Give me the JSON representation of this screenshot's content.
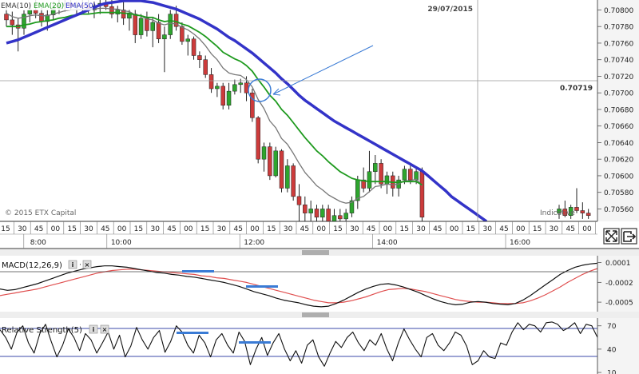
{
  "chart_data": [
    {
      "type": "candlestick",
      "legend": [
        "EMA(10)",
        "EMA(20)",
        "EMA(50)"
      ],
      "date_label": "29/07/2015",
      "price_label": "0.70719",
      "watermark": "© 2015 ETX Capital",
      "indicative": "Indicative",
      "y_ticks": [
        "0.70800",
        "0.70780",
        "0.70760",
        "0.70740",
        "0.70720",
        "0.70700",
        "0.70680",
        "0.70660",
        "0.70640",
        "0.70620",
        "0.70600",
        "0.70580",
        "0.70560"
      ],
      "ylim": [
        0.70545,
        0.70812
      ],
      "candles": [
        [
          0.70795,
          0.70805,
          0.7078,
          0.70788
        ],
        [
          0.70788,
          0.70798,
          0.7077,
          0.70782
        ],
        [
          0.70782,
          0.7079,
          0.7075,
          0.70778
        ],
        [
          0.70778,
          0.708,
          0.7077,
          0.70795
        ],
        [
          0.70795,
          0.70808,
          0.70785,
          0.708
        ],
        [
          0.708,
          0.70812,
          0.7079,
          0.70796
        ],
        [
          0.70796,
          0.70806,
          0.7078,
          0.70786
        ],
        [
          0.70786,
          0.708,
          0.70775,
          0.70794
        ],
        [
          0.70794,
          0.7081,
          0.70788,
          0.70802
        ],
        [
          0.70802,
          0.70812,
          0.70795,
          0.70806
        ],
        [
          0.70806,
          0.70812,
          0.70798,
          0.70808
        ],
        [
          0.70808,
          0.70812,
          0.708,
          0.70804
        ],
        [
          0.70804,
          0.7081,
          0.70795,
          0.70806
        ],
        [
          0.70806,
          0.70812,
          0.70798,
          0.70804
        ],
        [
          0.70804,
          0.70812,
          0.70796,
          0.708
        ],
        [
          0.708,
          0.7081,
          0.7079,
          0.70805
        ],
        [
          0.70805,
          0.70812,
          0.70795,
          0.70808
        ],
        [
          0.70808,
          0.70812,
          0.708,
          0.70804
        ],
        [
          0.70804,
          0.70812,
          0.7079,
          0.70795
        ],
        [
          0.70795,
          0.70805,
          0.70785,
          0.708
        ],
        [
          0.708,
          0.7081,
          0.70782,
          0.7079
        ],
        [
          0.7079,
          0.708,
          0.70775,
          0.70795
        ],
        [
          0.70795,
          0.708,
          0.7076,
          0.7077
        ],
        [
          0.7077,
          0.70795,
          0.70765,
          0.7079
        ],
        [
          0.7079,
          0.70798,
          0.70768,
          0.70775
        ],
        [
          0.70775,
          0.7079,
          0.70755,
          0.70785
        ],
        [
          0.70785,
          0.70795,
          0.7076,
          0.70765
        ],
        [
          0.70765,
          0.7078,
          0.70725,
          0.7077
        ],
        [
          0.7077,
          0.708,
          0.70765,
          0.70795
        ],
        [
          0.70795,
          0.70805,
          0.70775,
          0.7078
        ],
        [
          0.7078,
          0.70785,
          0.70758,
          0.70762
        ],
        [
          0.70762,
          0.7077,
          0.70745,
          0.70765
        ],
        [
          0.70765,
          0.70768,
          0.7074,
          0.70745
        ],
        [
          0.70745,
          0.7075,
          0.7073,
          0.7074
        ],
        [
          0.7074,
          0.70745,
          0.70718,
          0.70722
        ],
        [
          0.70722,
          0.7073,
          0.707,
          0.70705
        ],
        [
          0.70705,
          0.70712,
          0.70695,
          0.70708
        ],
        [
          0.70708,
          0.70712,
          0.7068,
          0.70685
        ],
        [
          0.70685,
          0.70712,
          0.7068,
          0.70702
        ],
        [
          0.70702,
          0.70716,
          0.70698,
          0.7071
        ],
        [
          0.7071,
          0.70717,
          0.707,
          0.70712
        ],
        [
          0.70712,
          0.7072,
          0.7069,
          0.707
        ],
        [
          0.707,
          0.70705,
          0.70665,
          0.7067
        ],
        [
          0.7067,
          0.70672,
          0.70615,
          0.7062
        ],
        [
          0.7062,
          0.7064,
          0.70605,
          0.70635
        ],
        [
          0.70635,
          0.7064,
          0.70595,
          0.706
        ],
        [
          0.706,
          0.70635,
          0.70598,
          0.7063
        ],
        [
          0.7063,
          0.70632,
          0.7058,
          0.70585
        ],
        [
          0.70585,
          0.7062,
          0.7058,
          0.70612
        ],
        [
          0.70612,
          0.70615,
          0.7057,
          0.70575
        ],
        [
          0.70575,
          0.7059,
          0.70545,
          0.70565
        ],
        [
          0.70565,
          0.70575,
          0.70545,
          0.70555
        ],
        [
          0.70555,
          0.7057,
          0.7054,
          0.7056
        ],
        [
          0.7056,
          0.70565,
          0.70545,
          0.7055
        ],
        [
          0.7055,
          0.70565,
          0.70545,
          0.7056
        ],
        [
          0.7056,
          0.70565,
          0.7054,
          0.70545
        ],
        [
          0.70545,
          0.7056,
          0.7054,
          0.70552
        ],
        [
          0.70552,
          0.7056,
          0.70542,
          0.70548
        ],
        [
          0.70548,
          0.7056,
          0.70545,
          0.70555
        ],
        [
          0.70555,
          0.70575,
          0.7055,
          0.7057
        ],
        [
          0.7057,
          0.706,
          0.7056,
          0.70595
        ],
        [
          0.70595,
          0.7061,
          0.7058,
          0.70585
        ],
        [
          0.70585,
          0.7063,
          0.7058,
          0.70605
        ],
        [
          0.70605,
          0.70625,
          0.7059,
          0.70615
        ],
        [
          0.70615,
          0.7062,
          0.70585,
          0.7059
        ],
        [
          0.7059,
          0.70605,
          0.70578,
          0.706
        ],
        [
          0.706,
          0.70605,
          0.70575,
          0.70585
        ],
        [
          0.70585,
          0.706,
          0.70575,
          0.70595
        ],
        [
          0.70595,
          0.70612,
          0.7059,
          0.70608
        ],
        [
          0.70608,
          0.70612,
          0.7059,
          0.70595
        ],
        [
          0.70595,
          0.7061,
          0.7059,
          0.70605
        ],
        [
          0.70605,
          0.7061,
          0.7054,
          0.7055
        ]
      ],
      "candles_right": [
        [
          0.70555,
          0.70565,
          0.70548,
          0.7056
        ],
        [
          0.7056,
          0.7057,
          0.7055,
          0.70552
        ],
        [
          0.70552,
          0.70565,
          0.70548,
          0.70562
        ],
        [
          0.70562,
          0.70585,
          0.70555,
          0.70558
        ],
        [
          0.70558,
          0.70568,
          0.70548,
          0.70555
        ],
        [
          0.70555,
          0.7056,
          0.70548,
          0.70552
        ]
      ],
      "ema10": [
        0.70796,
        0.70792,
        0.7079,
        0.70791,
        0.70793,
        0.70794,
        0.70793,
        0.70793,
        0.70795,
        0.70797,
        0.70799,
        0.708,
        0.708,
        0.70801,
        0.70801,
        0.70801,
        0.70802,
        0.70802,
        0.70801,
        0.70801,
        0.70799,
        0.70798,
        0.70794,
        0.70793,
        0.70789,
        0.70788,
        0.70784,
        0.70782,
        0.70784,
        0.70783,
        0.70779,
        0.70776,
        0.70771,
        0.70765,
        0.70757,
        0.70747,
        0.7074,
        0.7073,
        0.70724,
        0.70722,
        0.70721,
        0.70716,
        0.70707,
        0.70692,
        0.70681,
        0.70666,
        0.70658,
        0.70645,
        0.70638,
        0.70627,
        0.70615,
        0.70604,
        0.70596,
        0.70588,
        0.70583,
        0.70577,
        0.70573,
        0.70569,
        0.70567,
        0.70568,
        0.70573,
        0.70575,
        0.70581,
        0.70587,
        0.70588,
        0.7059,
        0.70589,
        0.7059,
        0.70594,
        0.70594,
        0.70596,
        0.70588
      ],
      "ema20": [
        0.7078,
        0.7078,
        0.7078,
        0.70782,
        0.70783,
        0.70785,
        0.70786,
        0.70787,
        0.70788,
        0.7079,
        0.70791,
        0.70793,
        0.70794,
        0.70795,
        0.70795,
        0.70796,
        0.70797,
        0.70797,
        0.70797,
        0.70797,
        0.70796,
        0.70796,
        0.70794,
        0.70793,
        0.70791,
        0.70791,
        0.70788,
        0.70786,
        0.70787,
        0.70786,
        0.70783,
        0.70781,
        0.70777,
        0.70773,
        0.70768,
        0.70762,
        0.70756,
        0.70749,
        0.70745,
        0.70741,
        0.70738,
        0.70733,
        0.70726,
        0.70716,
        0.70707,
        0.70697,
        0.7069,
        0.7068,
        0.70673,
        0.70664,
        0.70655,
        0.70646,
        0.70638,
        0.7063,
        0.70624,
        0.70617,
        0.70611,
        0.70605,
        0.70601,
        0.70597,
        0.70595,
        0.70594,
        0.70593,
        0.70593,
        0.70593,
        0.70593,
        0.70592,
        0.70592,
        0.70593,
        0.70593,
        0.70593,
        0.70589
      ],
      "ema50": [
        0.7076,
        0.70762,
        0.70764,
        0.70767,
        0.7077,
        0.70773,
        0.70776,
        0.70779,
        0.70782,
        0.70785,
        0.70788,
        0.70791,
        0.70794,
        0.70797,
        0.708,
        0.70803,
        0.70806,
        0.70808,
        0.70809,
        0.7081,
        0.70811,
        0.70811,
        0.70811,
        0.70811,
        0.7081,
        0.70809,
        0.70807,
        0.70805,
        0.70803,
        0.70801,
        0.70798,
        0.70795,
        0.70792,
        0.70789,
        0.70785,
        0.70781,
        0.70777,
        0.70772,
        0.70767,
        0.70763,
        0.70758,
        0.70753,
        0.70748,
        0.70742,
        0.70736,
        0.7073,
        0.70724,
        0.70717,
        0.70711,
        0.70704,
        0.70697,
        0.70691,
        0.70686,
        0.70681,
        0.70676,
        0.70671,
        0.70666,
        0.70662,
        0.70658,
        0.70654,
        0.7065,
        0.70646,
        0.70642,
        0.70638,
        0.70634,
        0.7063,
        0.70626,
        0.70622,
        0.70618,
        0.70614,
        0.7061,
        0.70606,
        0.706,
        0.70594,
        0.70588,
        0.70582,
        0.70575,
        0.7057,
        0.70565,
        0.7056,
        0.70555,
        0.7055,
        0.70545
      ],
      "x_ticks": [
        "15",
        "30",
        "45",
        "00",
        "15",
        "30",
        "45",
        "00",
        "15",
        "30",
        "45",
        "00",
        "15",
        "30",
        "45",
        "00",
        "15",
        "30",
        "45",
        "00",
        "15",
        "30",
        "45",
        "00",
        "15",
        "30",
        "45",
        "00",
        "15",
        "30",
        "45",
        "00",
        "15",
        "30",
        "45",
        "00"
      ],
      "x_hours": [
        {
          "label": "8:00",
          "index": 1
        },
        {
          "label": "10:00",
          "index": 6
        },
        {
          "label": "12:00",
          "index": 14
        },
        {
          "label": "14:00",
          "index": 22
        },
        {
          "label": "16:00",
          "index": 30
        }
      ]
    },
    {
      "type": "line",
      "title": "MACD(12,26,9)",
      "y_ticks": [
        "0.0001",
        "-0.0002",
        "-0.0005"
      ],
      "ylim": [
        -0.00062,
        0.00018
      ],
      "macd": [
        -0.0003,
        -0.00032,
        -0.00031,
        -0.00028,
        -0.00025,
        -0.00022,
        -0.00018,
        -0.00014,
        -0.0001,
        -6e-05,
        -3e-05,
        0.0,
        2e-05,
        4e-05,
        5e-05,
        5e-05,
        4e-05,
        3e-05,
        1e-05,
        -1e-05,
        -3e-05,
        -5e-05,
        -6e-05,
        -8e-05,
        -9e-05,
        -0.00011,
        -0.00012,
        -0.00014,
        -0.00016,
        -0.00018,
        -0.0002,
        -0.00023,
        -0.00026,
        -0.0003,
        -0.00034,
        -0.00037,
        -0.0004,
        -0.00044,
        -0.00047,
        -0.00049,
        -0.00051,
        -0.00054,
        -0.00056,
        -0.00057,
        -0.00056,
        -0.00052,
        -0.00047,
        -0.00041,
        -0.00035,
        -0.0003,
        -0.00026,
        -0.00023,
        -0.00022,
        -0.00024,
        -0.00027,
        -0.00031,
        -0.00035,
        -0.0004,
        -0.00045,
        -0.00049,
        -0.00052,
        -0.00054,
        -0.00053,
        -0.0005,
        -0.00049,
        -0.0005,
        -0.00052,
        -0.00053,
        -0.00054,
        -0.00052,
        -0.00047,
        -0.0004,
        -0.00032,
        -0.00024,
        -0.00016,
        -8e-05,
        -2e-05,
        3e-05,
        6e-05,
        8e-05,
        9e-05
      ],
      "signal": [
        -0.0004,
        -0.00038,
        -0.00036,
        -0.00034,
        -0.00032,
        -0.0003,
        -0.00027,
        -0.00024,
        -0.00021,
        -0.00018,
        -0.00015,
        -0.00012,
        -9e-05,
        -6e-05,
        -4e-05,
        -2e-05,
        -1e-05,
        0.0,
        0.0,
        -1e-05,
        -2e-05,
        -3e-05,
        -4e-05,
        -5e-05,
        -6e-05,
        -7e-05,
        -8e-05,
        -0.0001,
        -0.00011,
        -0.00013,
        -0.00014,
        -0.00016,
        -0.00018,
        -0.0002,
        -0.00023,
        -0.00026,
        -0.00029,
        -0.00032,
        -0.00035,
        -0.00038,
        -0.00041,
        -0.00044,
        -0.00047,
        -0.00049,
        -0.00051,
        -0.00051,
        -0.0005,
        -0.00048,
        -0.00045,
        -0.00042,
        -0.00038,
        -0.00034,
        -0.00031,
        -0.0003,
        -0.00029,
        -0.0003,
        -0.00032,
        -0.00034,
        -0.00037,
        -0.0004,
        -0.00043,
        -0.00046,
        -0.00048,
        -0.00049,
        -0.0005,
        -0.0005,
        -0.00051,
        -0.00052,
        -0.00052,
        -0.00052,
        -0.00051,
        -0.00048,
        -0.00044,
        -0.00039,
        -0.00033,
        -0.00027,
        -0.0002,
        -0.00014,
        -8e-05,
        -3e-05,
        1e-05
      ]
    },
    {
      "type": "line",
      "title": "Relative Strength(5)",
      "y_ticks": [
        "70",
        "40",
        "10"
      ],
      "ylim": [
        8,
        80
      ],
      "rsi": [
        65,
        55,
        40,
        62,
        70,
        48,
        35,
        60,
        72,
        50,
        30,
        45,
        66,
        55,
        38,
        60,
        52,
        35,
        48,
        62,
        40,
        58,
        30,
        44,
        68,
        52,
        40,
        55,
        64,
        36,
        50,
        70,
        62,
        45,
        35,
        58,
        48,
        30,
        52,
        60,
        45,
        35,
        62,
        50,
        20,
        40,
        55,
        32,
        48,
        60,
        40,
        25,
        38,
        22,
        45,
        52,
        30,
        18,
        35,
        50,
        42,
        55,
        62,
        48,
        38,
        52,
        45,
        60,
        40,
        25,
        48,
        66,
        52,
        40,
        30,
        55,
        60,
        45,
        38,
        48,
        62,
        58,
        44,
        20,
        25,
        38,
        30,
        28,
        48,
        45,
        62,
        74,
        65,
        72,
        70,
        62,
        74,
        75,
        72,
        64,
        68,
        74,
        60,
        72,
        70,
        55
      ]
    }
  ],
  "colors": {
    "bull": "#2ea52e",
    "bear": "#cc3b3b",
    "ema10": "#777777",
    "ema20": "#1e9a1e",
    "ema50": "#3333c8",
    "macd": "#111111",
    "signal": "#e05050",
    "rsi": "#111111",
    "annotation": "#3a7bd5",
    "band": "#3b48a8"
  },
  "icons": {
    "zoom": "fullscreen-icon",
    "export": "export-icon",
    "info": "info-icon",
    "close": "close-icon"
  }
}
